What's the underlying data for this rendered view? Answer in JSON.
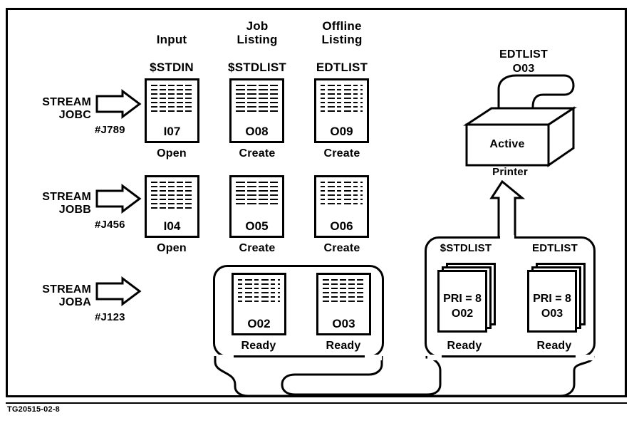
{
  "figure": {
    "caption": "TG20515-02-8",
    "columns": [
      {
        "title": "Input",
        "file": "$STDIN"
      },
      {
        "title": "Job\nListing",
        "file": "$STDLIST"
      },
      {
        "title": "Offline\nListing",
        "file": "EDTLIST"
      }
    ],
    "rows": [
      {
        "command": "STREAM\nJOBC",
        "jobnum": "#J789",
        "docs": [
          {
            "id": "I07",
            "state": "Open"
          },
          {
            "id": "O08",
            "state": "Create"
          },
          {
            "id": "O09",
            "state": "Create"
          }
        ]
      },
      {
        "command": "STREAM\nJOBB",
        "jobnum": "#J456",
        "docs": [
          {
            "id": "I04",
            "state": "Open"
          },
          {
            "id": "O05",
            "state": "Create"
          },
          {
            "id": "O06",
            "state": "Create"
          }
        ]
      },
      {
        "command": "STREAM\nJOBA",
        "jobnum": "#J123",
        "docs": [
          {
            "id": "O02",
            "state": "Ready"
          },
          {
            "id": "O03",
            "state": "Ready"
          }
        ]
      }
    ],
    "printer": {
      "header_file": "EDTLIST",
      "header_id": "O03",
      "body_label": "Active",
      "caption": "Printer"
    },
    "spool_queue": [
      {
        "file": "$STDLIST",
        "priority": "PRI = 8",
        "id": "O02",
        "state": "Ready"
      },
      {
        "file": "EDTLIST",
        "priority": "PRI = 8",
        "id": "O03",
        "state": "Ready"
      }
    ]
  }
}
